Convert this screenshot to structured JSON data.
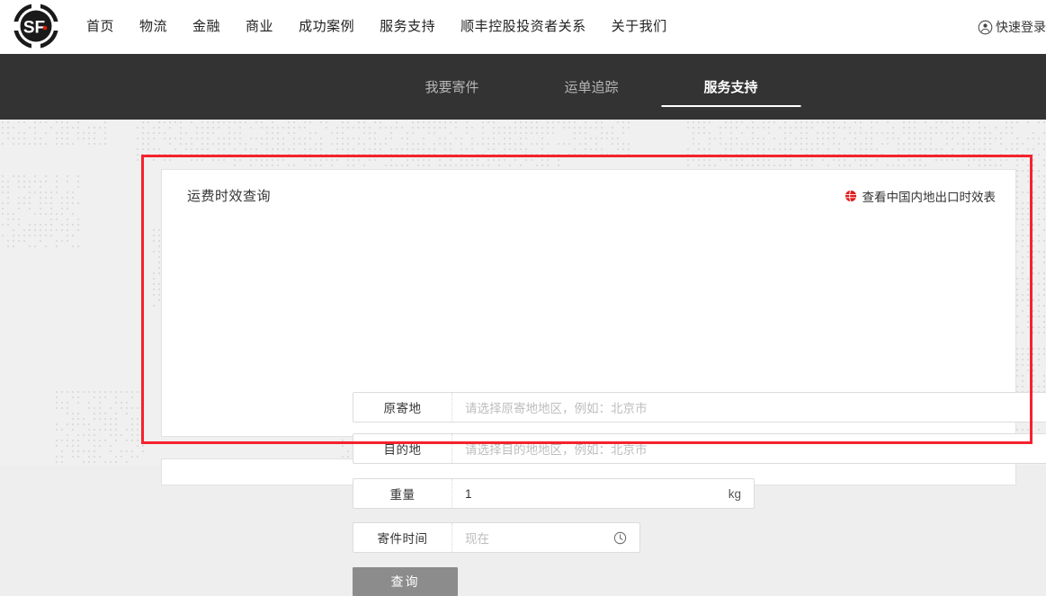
{
  "header": {
    "logo_alt": "SF Express",
    "nav": [
      {
        "label": "首页"
      },
      {
        "label": "物流"
      },
      {
        "label": "金融"
      },
      {
        "label": "商业"
      },
      {
        "label": "成功案例"
      },
      {
        "label": "服务支持"
      },
      {
        "label": "顺丰控股投资者关系"
      },
      {
        "label": "关于我们"
      }
    ],
    "login": {
      "label": "快速登录",
      "icon": "user-circle-icon"
    }
  },
  "subnav": {
    "tabs": [
      {
        "label": "我要寄件",
        "active": false
      },
      {
        "label": "运单追踪",
        "active": false
      },
      {
        "label": "服务支持",
        "active": true
      }
    ]
  },
  "card": {
    "title": "运费时效查询",
    "export_link": {
      "label": "查看中国内地出口时效表",
      "icon": "globe-icon"
    },
    "fields": [
      {
        "label": "原寄地",
        "value": "",
        "placeholder": "请选择原寄地地区，例如：北京市",
        "suffix": "",
        "trailing": "···"
      },
      {
        "label": "目的地",
        "value": "",
        "placeholder": "请选择目的地地区，例如：北京市",
        "suffix": "",
        "trailing": "···"
      },
      {
        "label": "重量",
        "value": "1",
        "placeholder": "",
        "suffix": "kg",
        "trailing": ""
      },
      {
        "label": "寄件时间",
        "value": "",
        "placeholder": "现在",
        "suffix": "",
        "trailing": "clock-icon"
      }
    ],
    "submit_label": "查询"
  },
  "colors": {
    "accent_red": "#f5222d",
    "subnav_bg": "#333333",
    "button_gray": "#8c8c8c",
    "page_bg": "#f0f0f0"
  }
}
